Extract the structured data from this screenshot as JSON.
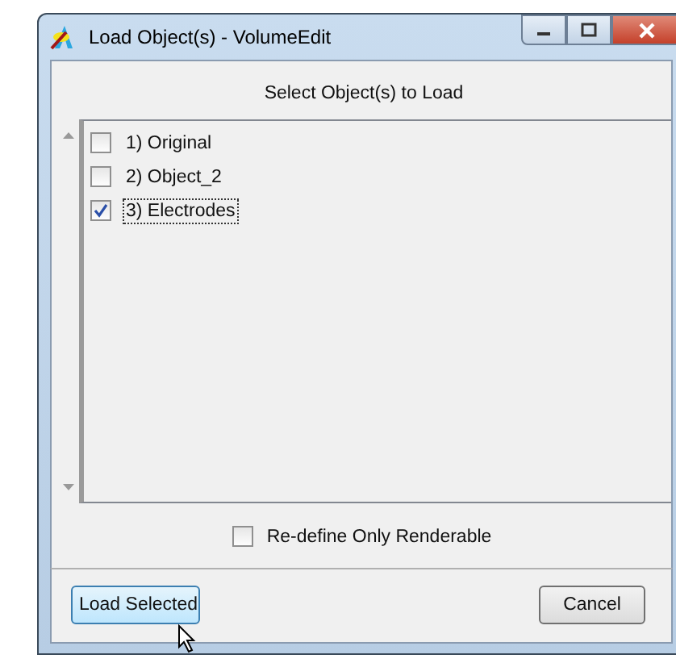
{
  "window": {
    "title": "Load Object(s) - VolumeEdit"
  },
  "heading": "Select Object(s) to Load",
  "objects": [
    {
      "label": "1) Original",
      "checked": false,
      "selected": false
    },
    {
      "label": "2) Object_2",
      "checked": false,
      "selected": false
    },
    {
      "label": "3) Electrodes",
      "checked": true,
      "selected": true
    }
  ],
  "option": {
    "label": "Re-define Only Renderable",
    "checked": false
  },
  "buttons": [
    {
      "label": "Load Selected",
      "kind": "primary"
    },
    {
      "label": "Cancel",
      "kind": "normal"
    }
  ]
}
